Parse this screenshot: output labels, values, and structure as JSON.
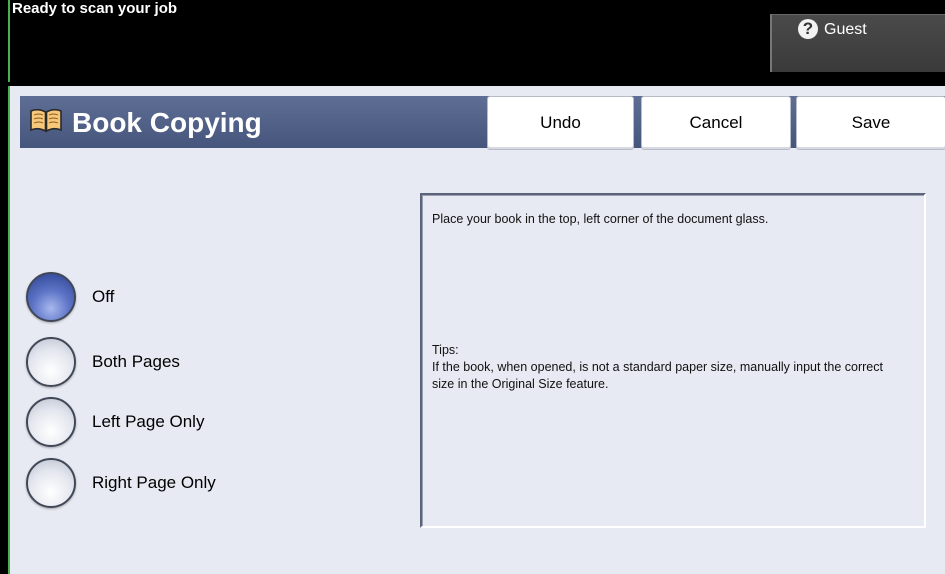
{
  "status": {
    "message": "Ready to scan your job",
    "user_label": "Guest",
    "user_icon": "question-icon"
  },
  "header": {
    "title": "Book Copying",
    "title_icon": "book-icon",
    "undo_label": "Undo",
    "cancel_label": "Cancel",
    "save_label": "Save"
  },
  "options": [
    {
      "label": "Off",
      "selected": true
    },
    {
      "label": "Both Pages",
      "selected": false
    },
    {
      "label": "Left Page Only",
      "selected": false
    },
    {
      "label": "Right Page Only",
      "selected": false
    }
  ],
  "info": {
    "instruction": "Place your book in the top, left corner of the document glass.",
    "tips_heading": "Tips:",
    "tips_text": "If the book, when opened, is not a standard paper size, manually input the correct size in the Original Size feature."
  },
  "colors": {
    "title_bar": "#4f5f86",
    "panel_background": "#e8eaf3",
    "selected_radio": "#4a62bb",
    "frame_accent": "#4caf50"
  }
}
